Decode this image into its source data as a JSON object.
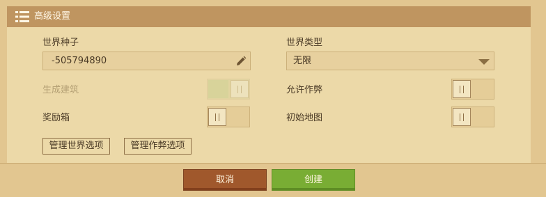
{
  "header": {
    "title": "高级设置",
    "icon": "list-settings-icon"
  },
  "seed": {
    "label": "世界种子",
    "value": "-505794890",
    "icon": "pencil-icon"
  },
  "world_type": {
    "label": "世界类型",
    "value": "无限",
    "icon": "chevron-down-icon"
  },
  "toggles": {
    "generate_structures": {
      "label": "生成建筑",
      "on": true,
      "disabled": true
    },
    "allow_cheats": {
      "label": "允许作弊",
      "on": false,
      "disabled": false
    },
    "bonus_chest": {
      "label": "奖励箱",
      "on": false,
      "disabled": false
    },
    "starting_map": {
      "label": "初始地图",
      "on": false,
      "disabled": false
    }
  },
  "buttons": {
    "manage_world_options": "管理世界选项",
    "manage_cheat_options": "管理作弊选项",
    "cancel": "取消",
    "create": "创建"
  },
  "colors": {
    "header": "#bf9560",
    "panel": "#ecd9a8",
    "background": "#e2c690",
    "cancel": "#a0582c",
    "create": "#79ad34"
  }
}
